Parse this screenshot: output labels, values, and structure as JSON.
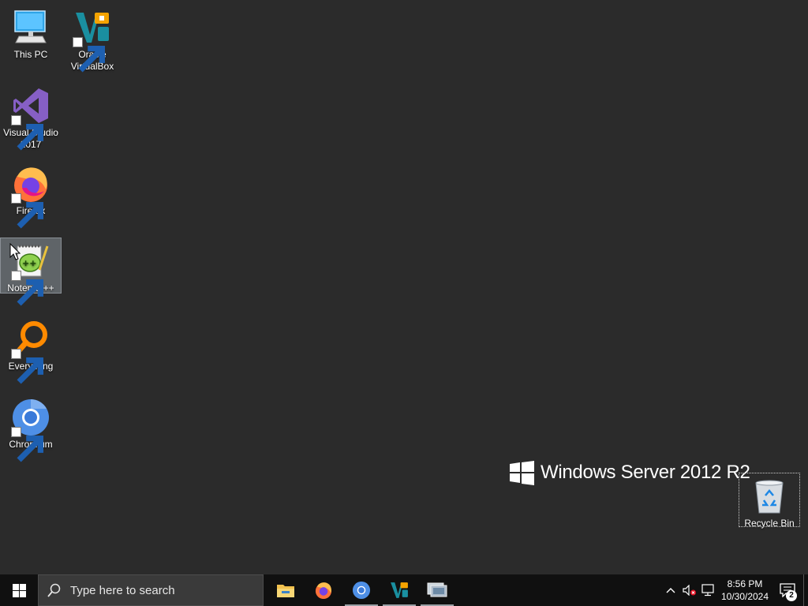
{
  "desktop": {
    "background": "#2b2b2b",
    "icons": [
      {
        "label": "This PC",
        "icon": "computer-icon"
      },
      {
        "label": "Oracle VirtualBox",
        "icon": "virtualbox-icon"
      },
      {
        "label": "Visual Studio 2017",
        "icon": "visual-studio-icon"
      },
      {
        "label": "Firefox",
        "icon": "firefox-icon"
      },
      {
        "label": "Notepad++",
        "icon": "notepad-plus-plus-icon",
        "selected": true
      },
      {
        "label": "Everything",
        "icon": "everything-search-icon"
      },
      {
        "label": "Chromium",
        "icon": "chromium-icon"
      },
      {
        "label": "Recycle Bin",
        "icon": "recycle-bin-icon"
      }
    ],
    "watermark": "Windows Server 2012 R2"
  },
  "taskbar": {
    "background": "#101010",
    "search_placeholder": "Type here to search",
    "pinned_apps": [
      {
        "name": "File Explorer",
        "icon": "file-explorer-icon"
      },
      {
        "name": "Firefox",
        "icon": "firefox-icon"
      },
      {
        "name": "Chromium",
        "icon": "chromium-icon",
        "running": true
      },
      {
        "name": "Oracle VirtualBox",
        "icon": "virtualbox-icon",
        "running": true
      },
      {
        "name": "Remote Desktop",
        "icon": "remote-desktop-icon",
        "running": true
      }
    ],
    "tray": {
      "time": "8:56 PM",
      "date": "10/30/2024",
      "notification_count": "2"
    }
  }
}
